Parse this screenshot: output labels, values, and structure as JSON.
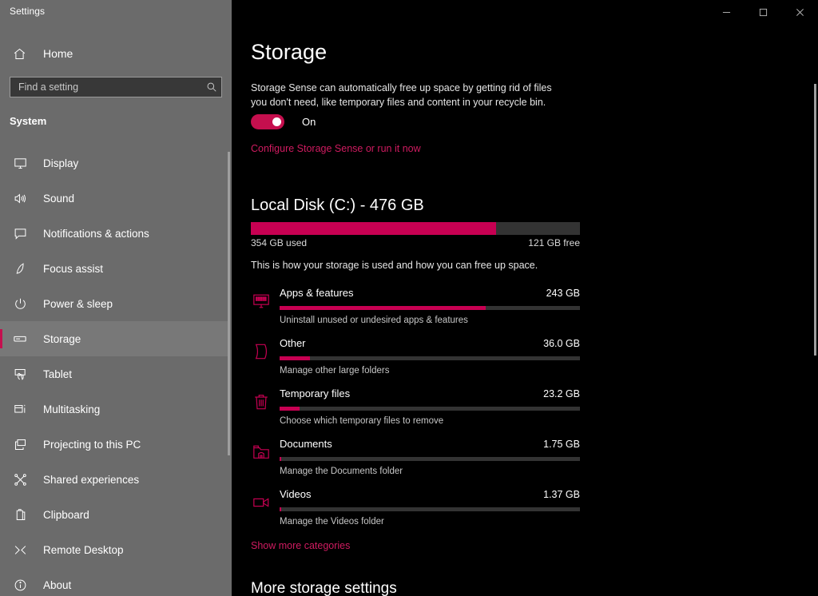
{
  "window": {
    "app_title": "Settings",
    "controls": [
      {
        "name": "minimize",
        "glyph": "─"
      },
      {
        "name": "maximize",
        "glyph": "☐"
      },
      {
        "name": "close",
        "glyph": "✕"
      }
    ]
  },
  "colors": {
    "accent": "#C70052",
    "accent_link": "#CF1B60",
    "toggle_on": "#C50F4E",
    "sidebar_bg": "#6b6b6b",
    "main_bg": "#000000",
    "track": "#333333"
  },
  "sidebar": {
    "home": {
      "label": "Home",
      "icon": "home-icon"
    },
    "search": {
      "placeholder": "Find a setting",
      "value": "",
      "icon": "search-icon"
    },
    "section": "System",
    "items": [
      {
        "label": "Display",
        "icon": "monitor-icon",
        "selected": false
      },
      {
        "label": "Sound",
        "icon": "speaker-icon",
        "selected": false
      },
      {
        "label": "Notifications & actions",
        "icon": "notification-icon",
        "selected": false
      },
      {
        "label": "Focus assist",
        "icon": "moon-icon",
        "selected": false
      },
      {
        "label": "Power & sleep",
        "icon": "power-icon",
        "selected": false
      },
      {
        "label": "Storage",
        "icon": "drive-icon",
        "selected": true
      },
      {
        "label": "Tablet",
        "icon": "tablet-icon",
        "selected": false
      },
      {
        "label": "Multitasking",
        "icon": "multitasking-icon",
        "selected": false
      },
      {
        "label": "Projecting to this PC",
        "icon": "projecting-icon",
        "selected": false
      },
      {
        "label": "Shared experiences",
        "icon": "share-icon",
        "selected": false
      },
      {
        "label": "Clipboard",
        "icon": "clipboard-icon",
        "selected": false
      },
      {
        "label": "Remote Desktop",
        "icon": "remote-desktop-icon",
        "selected": false
      },
      {
        "label": "About",
        "icon": "info-icon",
        "selected": false
      }
    ]
  },
  "main": {
    "page_title": "Storage",
    "storage_sense": {
      "description": "Storage Sense can automatically free up space by getting rid of files you don't need, like temporary files and content in your recycle bin.",
      "toggle_state": "On",
      "toggle_on": true,
      "configure_link": "Configure Storage Sense or run it now"
    },
    "disk": {
      "title": "Local Disk (C:) - 476 GB",
      "total_gb": 476,
      "used_label": "354 GB used",
      "free_label": "121 GB free",
      "used_gb": 354,
      "free_gb": 121,
      "used_percent": 74.4,
      "usage_note": "This is how your storage is used and how you can free up space."
    },
    "categories": [
      {
        "name": "Apps & features",
        "size": "243 GB",
        "size_gb": 243,
        "percent": 68.6,
        "sub": "Uninstall unused or undesired apps & features",
        "icon": "apps-monitor-icon"
      },
      {
        "name": "Other",
        "size": "36.0 GB",
        "size_gb": 36.0,
        "percent": 10.2,
        "sub": "Manage other large folders",
        "icon": "page-icon"
      },
      {
        "name": "Temporary files",
        "size": "23.2 GB",
        "size_gb": 23.2,
        "percent": 6.6,
        "sub": "Choose which temporary files to remove",
        "icon": "trash-icon"
      },
      {
        "name": "Documents",
        "size": "1.75 GB",
        "size_gb": 1.75,
        "percent": 0.5,
        "sub": "Manage the Documents folder",
        "icon": "documents-folder-icon"
      },
      {
        "name": "Videos",
        "size": "1.37 GB",
        "size_gb": 1.37,
        "percent": 0.4,
        "sub": "Manage the Videos folder",
        "icon": "video-camera-icon"
      }
    ],
    "show_more_link": "Show more categories",
    "more_settings_heading": "More storage settings"
  }
}
